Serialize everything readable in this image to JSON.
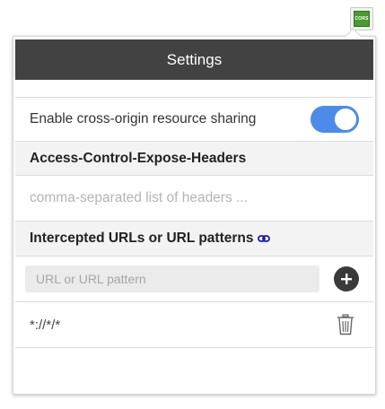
{
  "extension": {
    "badge_text": "CORS"
  },
  "header": {
    "title": "Settings"
  },
  "cors_toggle": {
    "label": "Enable cross-origin resource sharing",
    "enabled": true
  },
  "expose_headers": {
    "section_title": "Access-Control-Expose-Headers",
    "placeholder": "comma-separated list of headers ...",
    "value": ""
  },
  "urls": {
    "section_title": "Intercepted URLs or URL patterns",
    "input_placeholder": "URL or URL pattern",
    "patterns": [
      "*://*/*"
    ]
  },
  "icons": {
    "link": "link-icon",
    "add": "plus-circle-icon",
    "delete": "trash-icon",
    "extension": "cors-extension-icon"
  },
  "colors": {
    "header_bg": "#424242",
    "toggle_on": "#4c8be8",
    "link_icon": "#1a1aa6",
    "section_bg": "#f3f3f3"
  }
}
